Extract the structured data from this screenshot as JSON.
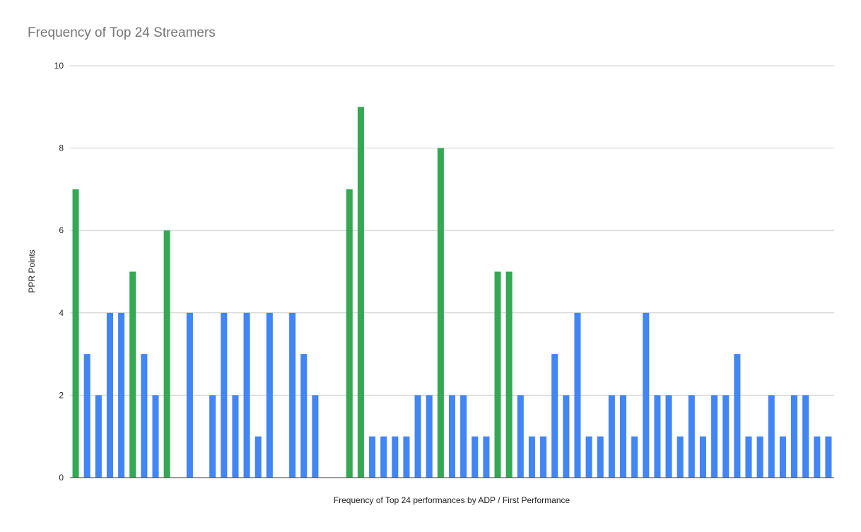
{
  "chart_data": {
    "type": "bar",
    "title": "Frequency of Top 24 Streamers",
    "xlabel": "Frequency of Top 24 performances by ADP / First Performance",
    "ylabel": "PPR Points",
    "ylim": [
      0,
      10
    ],
    "yticks": [
      0,
      2,
      4,
      6,
      8,
      10
    ],
    "grid": true,
    "legend": "none",
    "colors": {
      "default": "#4285f4",
      "highlight": "#34a853",
      "grid": "#cccccc",
      "baseline": "#333333"
    },
    "values": [
      7,
      3,
      2,
      4,
      4,
      5,
      3,
      2,
      6,
      0,
      4,
      0,
      2,
      4,
      2,
      4,
      1,
      4,
      0,
      4,
      3,
      2,
      0,
      0,
      7,
      9,
      1,
      1,
      1,
      1,
      2,
      2,
      8,
      2,
      2,
      1,
      1,
      5,
      5,
      2,
      1,
      1,
      3,
      2,
      4,
      1,
      1,
      2,
      2,
      1,
      4,
      2,
      2,
      1,
      2,
      1,
      2,
      2,
      3,
      1,
      1,
      2,
      1,
      2,
      2,
      1,
      1
    ],
    "highlighted": [
      0,
      5,
      8,
      24,
      25,
      32,
      37,
      38
    ]
  }
}
